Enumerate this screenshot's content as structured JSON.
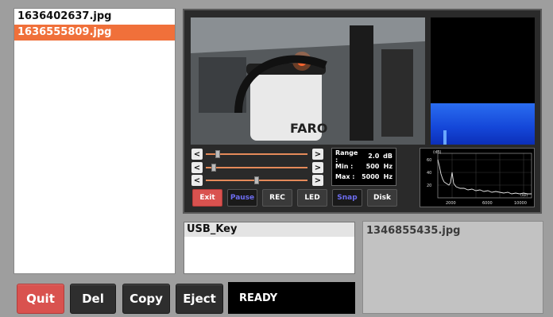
{
  "file_list": {
    "items": [
      "1636402637.jpg",
      "1636555809.jpg"
    ],
    "selected_index": 1
  },
  "bottom_buttons": {
    "quit": "Quit",
    "del": "Del",
    "copy": "Copy",
    "eject": "Eject"
  },
  "status": "READY",
  "camera": {
    "video_label": "FARO",
    "range": {
      "range_label": "Range :",
      "range_value": "2.0",
      "range_unit": "dB",
      "min_label": "Min :",
      "min_value": "500",
      "min_unit": "Hz",
      "max_label": "Max :",
      "max_value": "5000",
      "max_unit": "Hz"
    },
    "sliders": [
      {
        "level": 0.1
      },
      {
        "level": 0.06
      },
      {
        "level": 0.5
      }
    ],
    "buttons": {
      "exit": "Exit",
      "pause": "Pause",
      "rec": "REC",
      "led": "LED",
      "snap": "Snap",
      "disk": "Disk"
    },
    "fft": {
      "ylabel": "(dB)",
      "xlabel": "(Hz)",
      "yticks": [
        "60",
        "40",
        "20"
      ],
      "xticks": [
        "2000",
        "6000",
        "10000"
      ]
    }
  },
  "usb": {
    "title": "USB_Key"
  },
  "preview": {
    "filename": "1346855435.jpg"
  },
  "colors": {
    "selected": "#f0703a",
    "danger": "#d9524f",
    "spectro_blue": "#1446d8"
  }
}
